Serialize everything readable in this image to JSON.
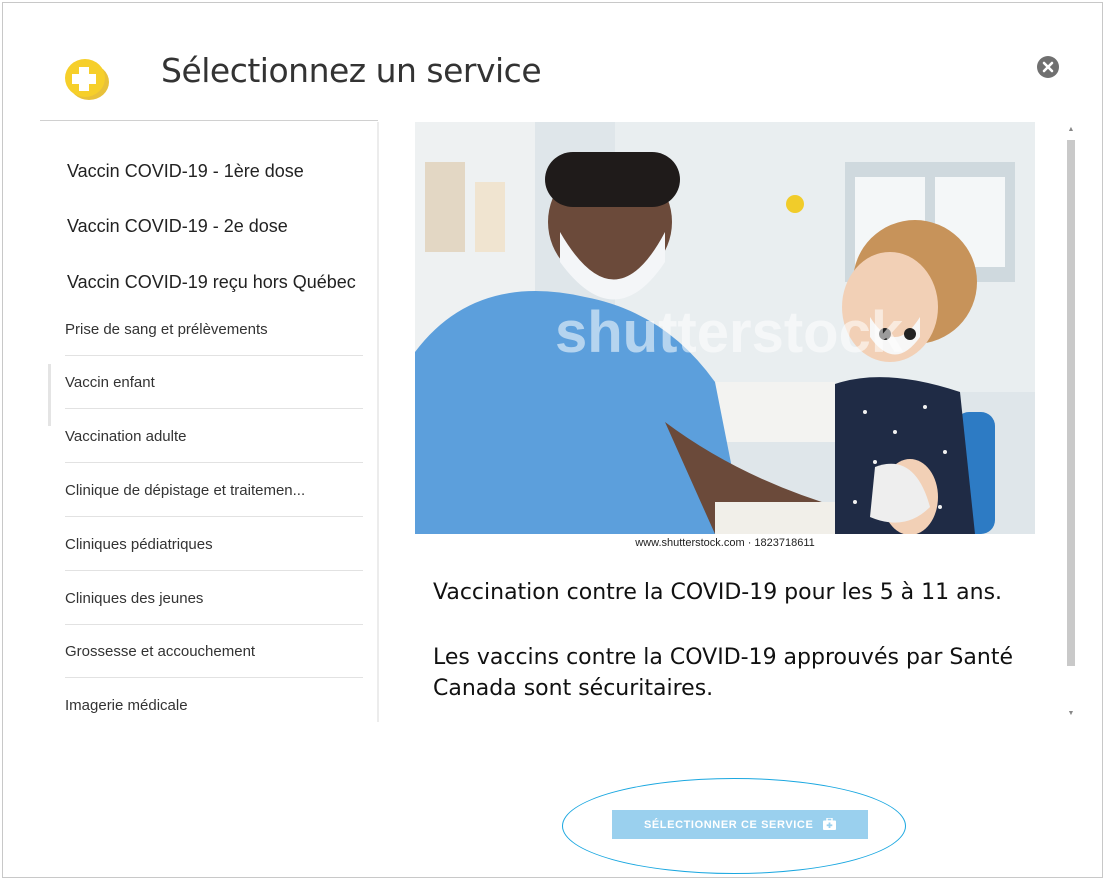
{
  "header": {
    "title": "Sélectionnez un service"
  },
  "services_top": [
    {
      "label": "Vaccin COVID-19 - 1ère dose"
    },
    {
      "label": "Vaccin COVID-19 - 2e dose"
    },
    {
      "label": "Vaccin COVID-19 reçu hors Québec"
    }
  ],
  "services": [
    {
      "label": "Prise de sang et prélèvements"
    },
    {
      "label": "Vaccin enfant"
    },
    {
      "label": "Vaccination adulte"
    },
    {
      "label": "Clinique de dépistage et traitemen..."
    },
    {
      "label": "Cliniques pédiatriques"
    },
    {
      "label": "Cliniques des jeunes"
    },
    {
      "label": "Grossesse et accouchement"
    },
    {
      "label": "Imagerie médicale"
    }
  ],
  "detail": {
    "image_caption": "www.shutterstock.com · 1823718611",
    "watermark": "shutterstock",
    "paragraph_1": "Vaccination contre la COVID-19 pour les 5 à 11 ans.",
    "paragraph_2": "Les vaccins contre la COVID-19 approuvés par Santé Canada sont sécuritaires."
  },
  "actions": {
    "select_label": "SÉLECTIONNER CE SERVICE"
  },
  "icons": {
    "logo": "plus-shield-icon",
    "close": "close-circle-icon",
    "select": "medical-bag-icon"
  },
  "colors": {
    "logo_yellow": "#f3c623",
    "button_blue": "#9ad0ee",
    "annotation_blue": "#1aa7e0"
  }
}
